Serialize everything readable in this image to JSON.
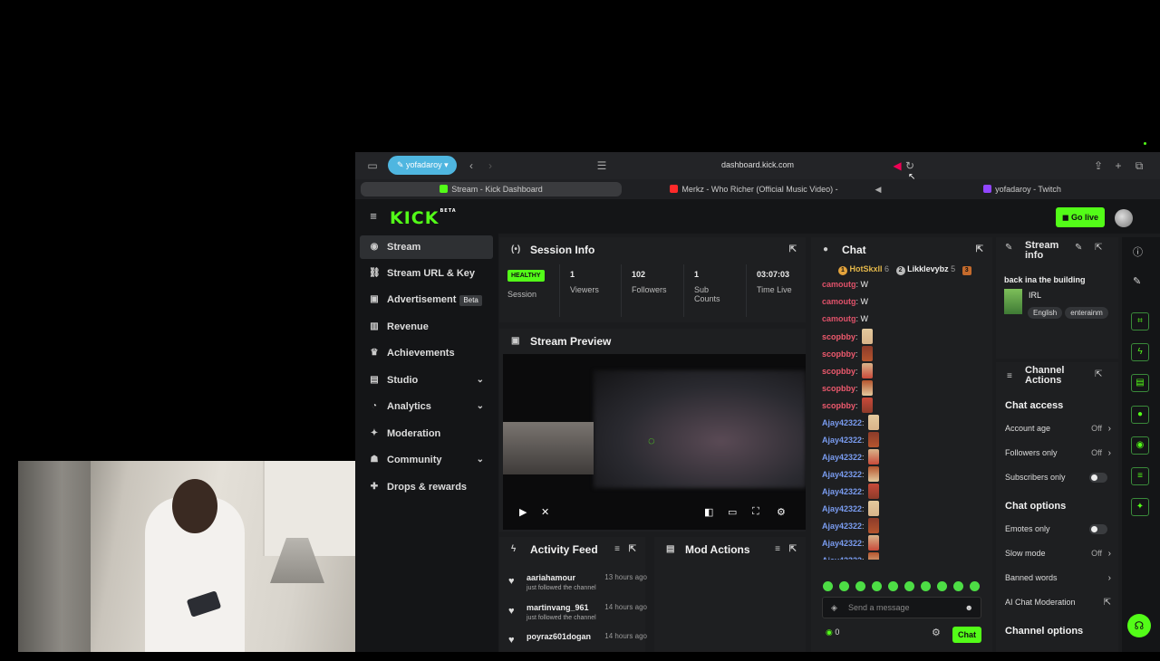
{
  "browser": {
    "profile": "yofadaroy",
    "url": "dashboard.kick.com",
    "tabs": [
      {
        "label": "Stream - Kick Dashboard",
        "color": "#53fc18"
      },
      {
        "label": "Merkz - Who Richer (Official Music Video) - YouTube",
        "color": "#ff2a2a"
      },
      {
        "label": "yofadaroy - Twitch",
        "color": "#9146ff"
      }
    ]
  },
  "header": {
    "logo": "KICK",
    "logo_badge": "BETA",
    "go_live": "Go live"
  },
  "sidebar": {
    "items": [
      {
        "label": "Stream",
        "icon": "broadcast-icon"
      },
      {
        "label": "Stream URL & Key",
        "icon": "link-icon"
      },
      {
        "label": "Advertisement",
        "icon": "ad-icon",
        "badge": "Beta"
      },
      {
        "label": "Revenue",
        "icon": "chart-icon"
      },
      {
        "label": "Achievements",
        "icon": "trophy-icon"
      },
      {
        "label": "Studio",
        "icon": "studio-icon"
      },
      {
        "label": "Analytics",
        "icon": "analytics-icon"
      },
      {
        "label": "Moderation",
        "icon": "wrench-icon"
      },
      {
        "label": "Community",
        "icon": "community-icon"
      },
      {
        "label": "Drops & rewards",
        "icon": "gift-icon"
      }
    ]
  },
  "session": {
    "title": "Session Info",
    "status": "HEALTHY",
    "status_label": "Session",
    "stats": [
      {
        "value": "1",
        "label": "Viewers"
      },
      {
        "value": "102",
        "label": "Followers"
      },
      {
        "value": "1",
        "label": "Sub Counts"
      },
      {
        "value": "03:07:03",
        "label": "Time Live"
      }
    ]
  },
  "preview": {
    "title": "Stream Preview"
  },
  "activity": {
    "title": "Activity Feed",
    "items": [
      {
        "user": "aariahamour",
        "time": "13 hours ago",
        "action": "just followed the channel"
      },
      {
        "user": "martinvang_961",
        "time": "14 hours ago",
        "action": "just followed the channel"
      },
      {
        "user": "poyraz601dogan",
        "time": "14 hours ago",
        "action": ""
      }
    ]
  },
  "mod_actions": {
    "title": "Mod Actions"
  },
  "chat": {
    "title": "Chat",
    "leaders": [
      {
        "rank": "1",
        "name": "HotSkxll",
        "count": "6"
      },
      {
        "rank": "2",
        "name": "Likklevybz",
        "count": "5"
      },
      {
        "rank": "3",
        "name": "",
        "count": ""
      }
    ],
    "messages": [
      {
        "user": "camoutg",
        "text": "W",
        "color": "#e0526a"
      },
      {
        "user": "camoutg",
        "text": "W",
        "color": "#e0526a"
      },
      {
        "user": "camoutg",
        "text": "W",
        "color": "#e0526a"
      },
      {
        "user": "scopbby",
        "text": "",
        "color": "#ef5a6e"
      },
      {
        "user": "scopbby",
        "text": "",
        "color": "#ef5a6e"
      },
      {
        "user": "scopbby",
        "text": "",
        "color": "#ef5a6e"
      },
      {
        "user": "scopbby",
        "text": "",
        "color": "#ef5a6e"
      },
      {
        "user": "scopbby",
        "text": "",
        "color": "#ef5a6e"
      },
      {
        "user": "Ajay42322",
        "text": "",
        "color": "#7a9cf0"
      },
      {
        "user": "Ajay42322",
        "text": "",
        "color": "#7a9cf0"
      },
      {
        "user": "Ajay42322",
        "text": "",
        "color": "#7a9cf0"
      },
      {
        "user": "Ajay42322",
        "text": "",
        "color": "#7a9cf0"
      },
      {
        "user": "Ajay42322",
        "text": "",
        "color": "#7a9cf0"
      },
      {
        "user": "Ajay42322",
        "text": "",
        "color": "#7a9cf0"
      },
      {
        "user": "Ajay42322",
        "text": "",
        "color": "#7a9cf0"
      },
      {
        "user": "Ajay42322",
        "text": "",
        "color": "#7a9cf0"
      },
      {
        "user": "Ajay42322",
        "text": "",
        "color": "#7a9cf0"
      }
    ],
    "input_placeholder": "Send a message",
    "points": "0",
    "send_label": "Chat"
  },
  "stream_info": {
    "title": "Stream info",
    "stream_title": "back ina the building",
    "category": "IRL",
    "tags": [
      "English",
      "enterainm"
    ]
  },
  "channel_actions": {
    "title": "Channel Actions",
    "chat_access": "Chat access",
    "account_age": {
      "label": "Account age",
      "value": "Off"
    },
    "followers_only": {
      "label": "Followers only",
      "value": "Off"
    },
    "subscribers_only": {
      "label": "Subscribers only"
    },
    "chat_options": "Chat options",
    "emotes_only": {
      "label": "Emotes only"
    },
    "slow_mode": {
      "label": "Slow mode",
      "value": "Off"
    },
    "banned_words": {
      "label": "Banned words"
    },
    "ai_moderation": {
      "label": "AI Chat Moderation"
    },
    "channel_options": "Channel options"
  },
  "colors": {
    "accent": "#53fc18",
    "panel": "#1e1f21",
    "background": "#141517"
  }
}
